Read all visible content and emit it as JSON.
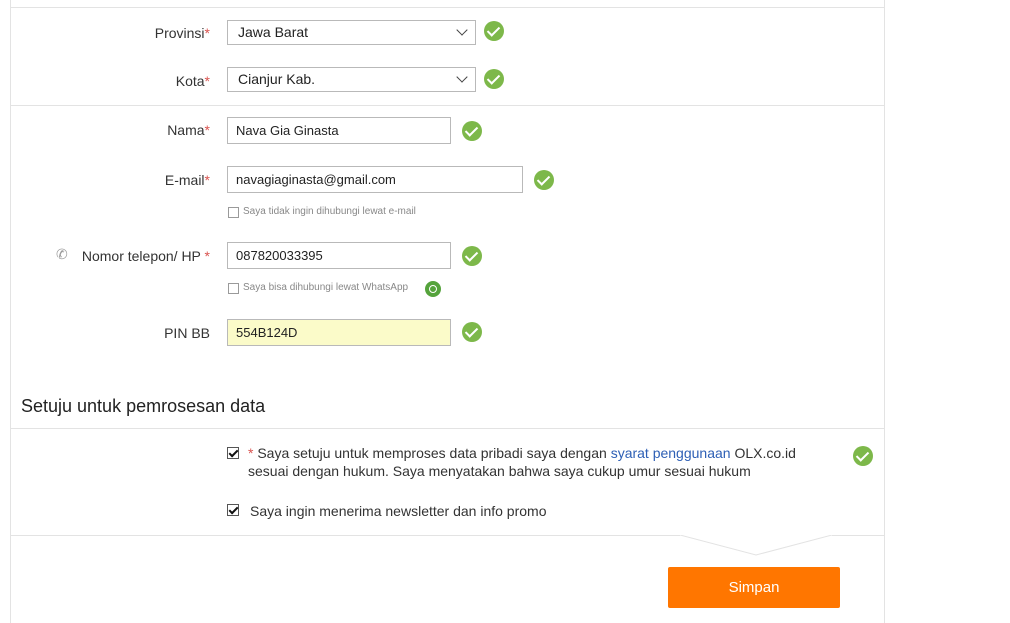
{
  "form": {
    "provinsi": {
      "label": "Provinsi",
      "req": "*",
      "value": "Jawa Barat"
    },
    "kota": {
      "label": "Kota",
      "req": "*",
      "value": "Cianjur Kab."
    },
    "nama": {
      "label": "Nama",
      "req": "*",
      "value": "Nava Gia Ginasta"
    },
    "email": {
      "label": "E-mail",
      "req": "*",
      "value": "navagiaginasta@gmail.com",
      "opt_out": "Saya tidak ingin dihubungi lewat e-mail"
    },
    "phone": {
      "label": "Nomor telepon/ HP",
      "req": "*",
      "value": "087820033395",
      "whatsapp": "Saya bisa dihubungi lewat WhatsApp"
    },
    "pinbb": {
      "label": "PIN BB",
      "value": "554B124D"
    }
  },
  "consent_section": {
    "title": "Setuju untuk pemrosesan data",
    "agree_req": "*",
    "agree_text_1": "Saya setuju untuk memproses data pribadi saya dengan",
    "agree_link": "syarat penggunaan",
    "agree_text_2": "OLX.co.id",
    "agree_text_3": "sesuai dengan hukum. Saya menyatakan bahwa saya cukup umur sesuai hukum",
    "newsletter_text": "Saya ingin menerima newsletter dan info promo"
  },
  "actions": {
    "save_label": "Simpan"
  },
  "colors": {
    "accent": "#ff7600",
    "success": "#7db84a",
    "link": "#2d5fb5",
    "required": "#d9534f"
  }
}
